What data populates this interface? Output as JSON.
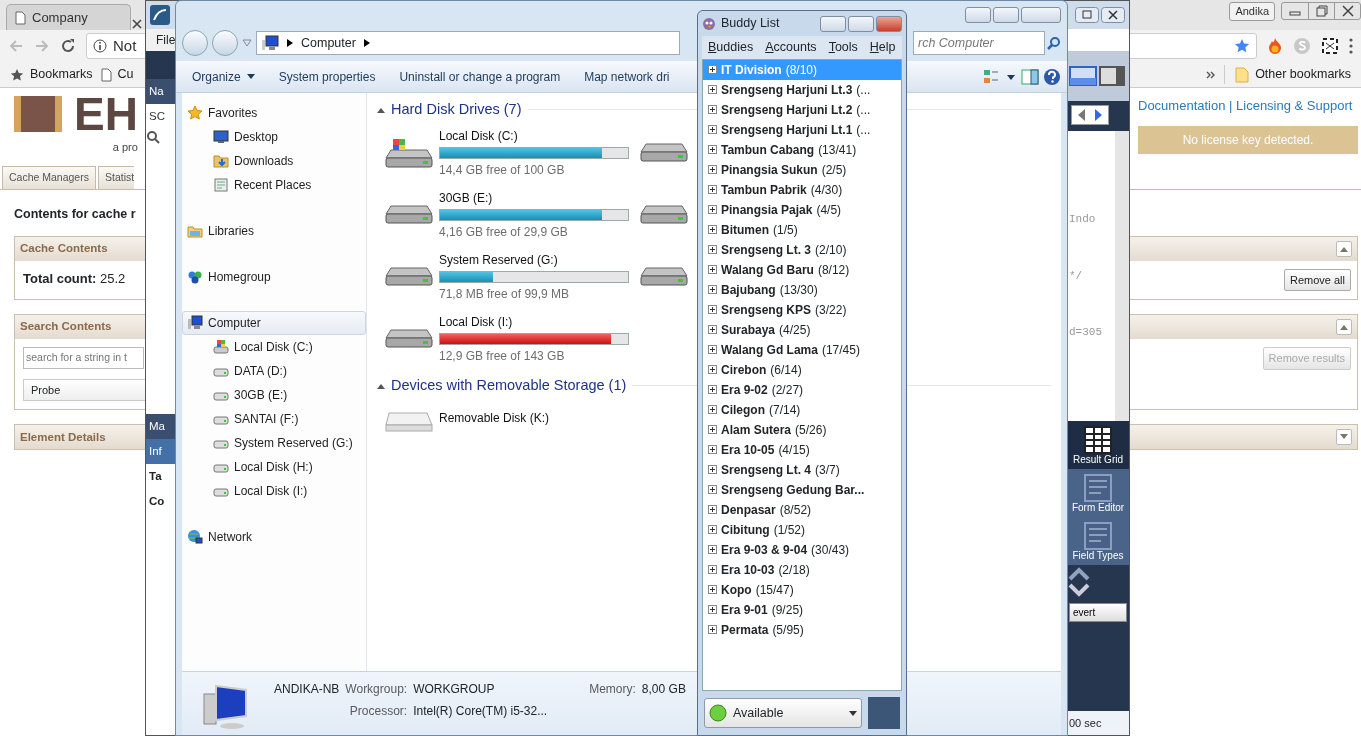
{
  "browser": {
    "tab_title": "Company",
    "address": "Not",
    "bookmarks": [
      "Bookmarks",
      "Cu"
    ],
    "other_bookmarks": "Other bookmarks",
    "profile": "Andika",
    "page": {
      "logo": "EH",
      "tagline": "a pro",
      "nav_tabs": [
        {
          "label": "Cache Managers",
          "selected": false
        },
        {
          "label": "Statist",
          "selected": false
        }
      ],
      "heading": "Contents for cache r",
      "links": "Documentation | Licensing & Support",
      "notice": "No license key detected.",
      "panels": [
        {
          "title": "Cache Contents",
          "expanded": true,
          "text": "**Total count:** 25.2",
          "button": {
            "label": "Remove all",
            "disabled": false
          }
        },
        {
          "title": "Search Contents",
          "expanded": true,
          "placeholder": "search for a string in t",
          "column": "Probe",
          "button": {
            "label": "Remove results",
            "disabled": true
          }
        },
        {
          "title": "Element Details",
          "expanded": false
        }
      ]
    }
  },
  "workbench": {
    "menu": "File",
    "left_labels": [
      {
        "kind": "header",
        "text": "Na"
      },
      {
        "kind": "plain",
        "text": "SC"
      },
      {
        "kind": "header",
        "text": "Ma"
      },
      {
        "kind": "tab",
        "text": "Inf"
      },
      {
        "kind": "bold",
        "text": "Ta"
      },
      {
        "kind": "bold",
        "text": "Co"
      }
    ],
    "code_lines": [
      "Indo",
      "*/",
      "d=305"
    ],
    "sidebar": [
      {
        "label": "Result Grid",
        "selected": true
      },
      {
        "label": "Form Editor",
        "selected": false
      },
      {
        "label": "Field Types",
        "selected": false
      }
    ],
    "revert": "evert",
    "timing": "00 sec"
  },
  "explorer": {
    "address": "Computer",
    "search_placeholder": "rch Computer",
    "toolbar": [
      {
        "label": "Organize",
        "menu": true
      },
      {
        "label": "System properties",
        "menu": false
      },
      {
        "label": "Uninstall or change a program",
        "menu": false
      },
      {
        "label": "Map network dri",
        "menu": false
      }
    ],
    "nav": [
      {
        "kind": "star",
        "label": "Favorites",
        "selected": false,
        "children": [
          {
            "kind": "desktop",
            "label": "Desktop",
            "selected": false
          },
          {
            "kind": "downloads",
            "label": "Downloads",
            "selected": false
          },
          {
            "kind": "recent",
            "label": "Recent Places",
            "selected": false
          }
        ]
      },
      {
        "kind": "libraries",
        "label": "Libraries",
        "selected": false
      },
      {
        "kind": "homegroup",
        "label": "Homegroup",
        "selected": false
      },
      {
        "kind": "computer",
        "label": "Computer",
        "selected": true,
        "children": [
          {
            "kind": "system",
            "label": "Local Disk (C:)",
            "selected": false
          },
          {
            "kind": "drive",
            "label": "DATA (D:)",
            "selected": false
          },
          {
            "kind": "drive",
            "label": "30GB (E:)",
            "selected": false
          },
          {
            "kind": "drive",
            "label": "SANTAI (F:)",
            "selected": false
          },
          {
            "kind": "drive",
            "label": "System Reserved (G:)",
            "selected": false
          },
          {
            "kind": "drive",
            "label": "Local Disk (H:)",
            "selected": false
          },
          {
            "kind": "drive",
            "label": "Local Disk (I:)",
            "selected": false
          }
        ]
      },
      {
        "kind": "network",
        "label": "Network",
        "selected": false
      }
    ],
    "groups": [
      {
        "title": "Hard Disk Drives (7)",
        "drives": [
          {
            "kind": "system",
            "name": "Local Disk (C:)",
            "free": "14,4 GB free of 100 GB",
            "level": 0.86,
            "critical": false
          },
          {
            "kind": "drive"
          },
          {
            "kind": "drive",
            "name": "30GB (E:)",
            "free": "4,16 GB free of 29,9 GB",
            "level": 0.86,
            "critical": false
          },
          {
            "kind": "drive"
          },
          {
            "kind": "drive",
            "name": "System Reserved (G:)",
            "free": "71,8 MB free of 99,9 MB",
            "level": 0.28,
            "critical": false
          },
          {
            "kind": "drive"
          },
          {
            "kind": "drive",
            "name": "Local Disk (I:)",
            "free": "12,9 GB free of 143 GB",
            "level": 0.91,
            "critical": true
          }
        ]
      },
      {
        "title": "Devices with Removable Storage (1)",
        "drives": [
          {
            "kind": "removable",
            "name": "Removable Disk (K:)"
          }
        ]
      }
    ],
    "details": {
      "computer": "ANDIKA-NB",
      "fields": [
        {
          "label": "Workgroup:",
          "value": "WORKGROUP"
        },
        {
          "label": "Memory:",
          "value": "8,00 GB"
        },
        {
          "label": "Processor:",
          "value": "Intel(R) Core(TM) i5-32..."
        }
      ]
    }
  },
  "buddy_list": {
    "title": "Buddy List",
    "menu": [
      "Buddies",
      "Accounts",
      "Tools",
      "Help"
    ],
    "groups": [
      {
        "name": "IT Division",
        "count": "(8/10)",
        "selected": true
      },
      {
        "name": "Srengseng Harjuni Lt.3",
        "count": "(...",
        "selected": false
      },
      {
        "name": "Srengseng Harjuni Lt.2",
        "count": "(...",
        "selected": false
      },
      {
        "name": "Srengseng Harjuni Lt.1",
        "count": "(...",
        "selected": false
      },
      {
        "name": "Tambun Cabang",
        "count": "(13/41)",
        "selected": false
      },
      {
        "name": "Pinangsia Sukun",
        "count": "(2/5)",
        "selected": false
      },
      {
        "name": "Tambun Pabrik",
        "count": "(4/30)",
        "selected": false
      },
      {
        "name": "Pinangsia Pajak",
        "count": "(4/5)",
        "selected": false
      },
      {
        "name": "Bitumen",
        "count": "(1/5)",
        "selected": false
      },
      {
        "name": "Srengseng Lt. 3",
        "count": "(2/10)",
        "selected": false
      },
      {
        "name": "Walang Gd Baru",
        "count": "(8/12)",
        "selected": false
      },
      {
        "name": "Bajubang",
        "count": "(13/30)",
        "selected": false
      },
      {
        "name": "Srengseng KPS",
        "count": "(3/22)",
        "selected": false
      },
      {
        "name": "Surabaya",
        "count": "(4/25)",
        "selected": false
      },
      {
        "name": "Walang Gd Lama",
        "count": "(17/45)",
        "selected": false
      },
      {
        "name": "Cirebon",
        "count": "(6/14)",
        "selected": false
      },
      {
        "name": "Era 9-02",
        "count": "(2/27)",
        "selected": false
      },
      {
        "name": "Cilegon",
        "count": "(7/14)",
        "selected": false
      },
      {
        "name": "Alam Sutera",
        "count": "(5/26)",
        "selected": false
      },
      {
        "name": "Era 10-05",
        "count": "(4/15)",
        "selected": false
      },
      {
        "name": "Srengseng Lt. 4",
        "count": "(3/7)",
        "selected": false
      },
      {
        "name": "Srengseng Gedung Bar...",
        "selected": false
      },
      {
        "name": "Denpasar",
        "count": "(8/52)",
        "selected": false
      },
      {
        "name": "Cibitung",
        "count": "(1/52)",
        "selected": false
      },
      {
        "name": "Era 9-03 & 9-04",
        "count": "(30/43)",
        "selected": false
      },
      {
        "name": "Era 10-03",
        "count": "(2/18)",
        "selected": false
      },
      {
        "name": "Kopo",
        "count": "(15/47)",
        "selected": false
      },
      {
        "name": "Era 9-01",
        "count": "(9/25)",
        "selected": false
      },
      {
        "name": "Permata",
        "count": "(5/95)",
        "selected": false
      }
    ],
    "status": "Available"
  }
}
